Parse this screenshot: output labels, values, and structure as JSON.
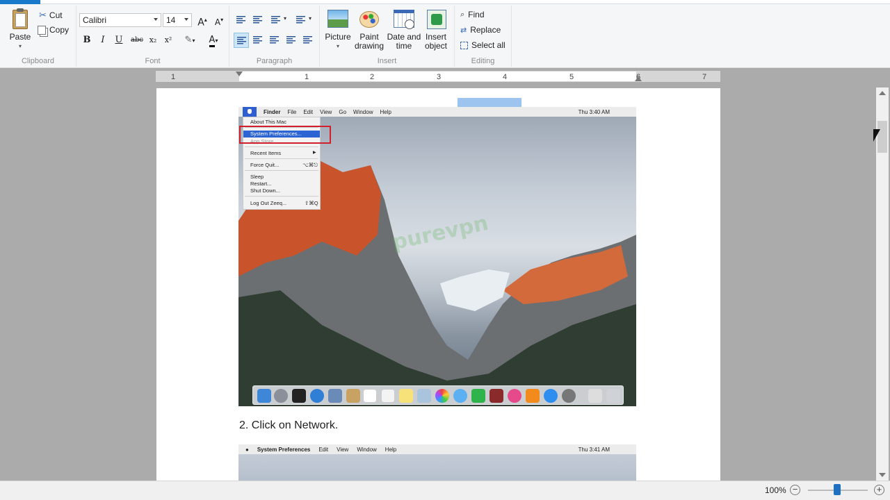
{
  "ribbon": {
    "clipboard": {
      "label": "Clipboard",
      "paste": "Paste",
      "cut": "Cut",
      "copy": "Copy"
    },
    "font": {
      "label": "Font",
      "family": "Calibri",
      "size": "14",
      "bold": "B",
      "italic": "I",
      "underline": "U",
      "strike": "abc",
      "subscript": "x₂",
      "superscript": "x²"
    },
    "paragraph": {
      "label": "Paragraph"
    },
    "insert": {
      "label": "Insert",
      "picture": "Picture",
      "paint_line1": "Paint",
      "paint_line2": "drawing",
      "date_line1": "Date and",
      "date_line2": "time",
      "object_line1": "Insert",
      "object_line2": "object"
    },
    "editing": {
      "label": "Editing",
      "find": "Find",
      "replace": "Replace",
      "select_all": "Select all"
    }
  },
  "ruler": {
    "numbers": [
      "1",
      "1",
      "2",
      "3",
      "4",
      "5",
      "6",
      "7"
    ]
  },
  "document": {
    "screenshot1": {
      "menubar": [
        "Finder",
        "File",
        "Edit",
        "View",
        "Go",
        "Window",
        "Help"
      ],
      "clock": "Thu 3:40 AM",
      "apple_menu": [
        "About This Mac",
        "System Preferences...",
        "App Store...",
        "Recent Items",
        "Force Quit...",
        "Sleep",
        "Restart...",
        "Shut Down...",
        "Log Out Zeeq..."
      ],
      "shortcut_force_quit": "⌥⌘⎋",
      "shortcut_logout": "⇧⌘Q",
      "watermark": "purevpn"
    },
    "caption": "2. Click on Network.",
    "screenshot2": {
      "menubar": [
        "System Preferences",
        "Edit",
        "View",
        "Window",
        "Help"
      ],
      "clock": "Thu 3:41 AM"
    }
  },
  "status": {
    "zoom": "100%"
  },
  "colors": {
    "accent": "#1979ca",
    "selection": "#2c64d4",
    "highlight_box": "#d0202c"
  }
}
